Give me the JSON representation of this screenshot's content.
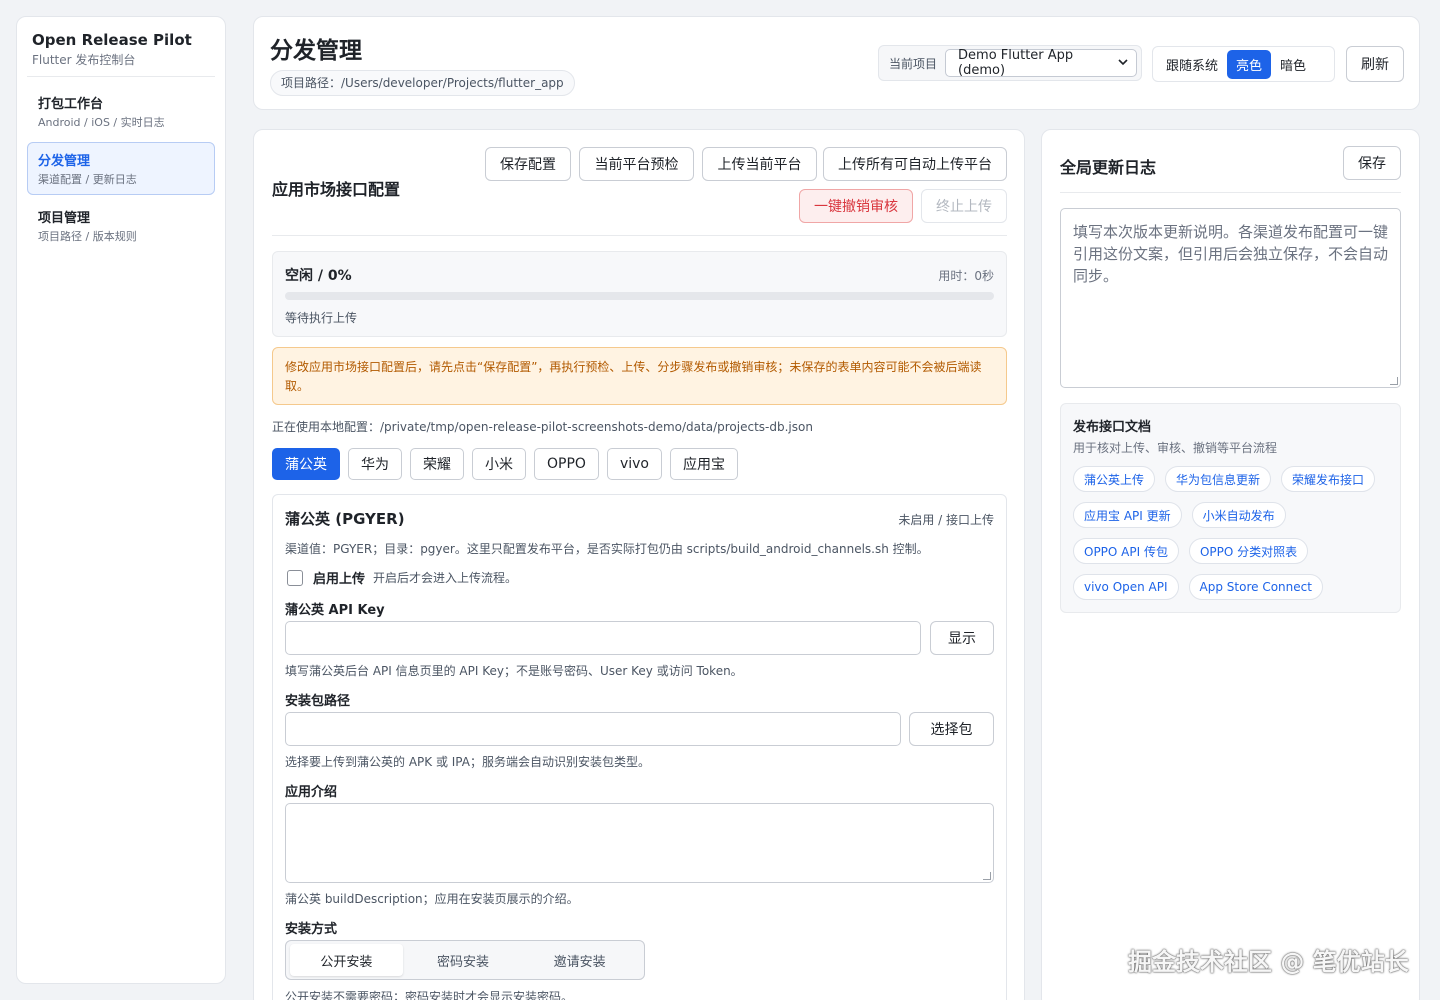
{
  "sidebar": {
    "brand_title": "Open Release Pilot",
    "brand_sub": "Flutter 发布控制台",
    "items": [
      {
        "title": "打包工作台",
        "sub": "Android / iOS / 实时日志"
      },
      {
        "title": "分发管理",
        "sub": "渠道配置 / 更新日志"
      },
      {
        "title": "项目管理",
        "sub": "项目路径 / 版本规则"
      }
    ]
  },
  "header": {
    "title": "分发管理",
    "path": "项目路径：/Users/developer/Projects/flutter_app",
    "project_label": "当前项目",
    "project_value": "Demo Flutter App (demo)",
    "theme": {
      "system": "跟随系统",
      "light": "亮色",
      "dark": "暗色"
    },
    "refresh": "刷新"
  },
  "main": {
    "title": "应用市场接口配置",
    "buttons": {
      "save": "保存配置",
      "precheck": "当前平台预检",
      "upload_current": "上传当前平台",
      "upload_all": "上传所有可自动上传平台",
      "revoke": "一键撤销审核",
      "stop": "终止上传"
    },
    "progress": {
      "status": "空闲 / 0%",
      "time": "用时：0秒",
      "percent": 0,
      "message": "等待执行上传"
    },
    "warning": "修改应用市场接口配置后，请先点击“保存配置”，再执行预检、上传、分步骤发布或撤销审核；未保存的表单内容可能不会被后端读取。",
    "local_config": "正在使用本地配置：/private/tmp/open-release-pilot-screenshots-demo/data/projects-db.json",
    "tabs": [
      "蒲公英",
      "华为",
      "荣耀",
      "小米",
      "OPPO",
      "vivo",
      "应用宝"
    ],
    "channel": {
      "title": "蒲公英 (PGYER)",
      "status": "未启用 / 接口上传",
      "desc": "渠道值：PGYER；目录：pgyer。这里只配置发布平台，是否实际打包仍由 scripts/build_android_channels.sh 控制。",
      "enable_label": "启用上传",
      "enable_hint": "开启后才会进入上传流程。",
      "api_key_label": "蒲公英 API Key",
      "api_key_value": "",
      "show_btn": "显示",
      "api_key_hint": "填写蒲公英后台 API 信息页里的 API Key；不是账号密码、User Key 或访问 Token。",
      "pkg_label": "安装包路径",
      "pkg_value": "",
      "choose_btn": "选择包",
      "pkg_hint": "选择要上传到蒲公英的 APK 或 IPA；服务端会自动识别安装包类型。",
      "desc_label": "应用介绍",
      "desc_value": "",
      "desc_hint": "蒲公英 buildDescription；应用在安装页展示的介绍。",
      "install_label": "安装方式",
      "install_options": [
        "公开安装",
        "密码安装",
        "邀请安装"
      ],
      "install_hint": "公开安装不需要密码；密码安装时才会显示安装密码。"
    }
  },
  "right": {
    "title": "全局更新日志",
    "save": "保存",
    "placeholder": "填写本次版本更新说明。各渠道发布配置可一键引用这份文案，但引用后会独立保存，不会自动同步。",
    "docs_title": "发布接口文档",
    "docs_sub": "用于核对上传、审核、撤销等平台流程",
    "links": [
      "蒲公英上传",
      "华为包信息更新",
      "荣耀发布接口",
      "应用宝 API 更新",
      "小米自动发布",
      "OPPO API 传包",
      "OPPO 分类对照表",
      "vivo Open API",
      "App Store Connect"
    ]
  },
  "watermark": "掘金技术社区 @ 笔优站长",
  "colors": {
    "accent": "#1d63e8",
    "danger": "#d9363e",
    "warning_text": "#b25a00",
    "warning_bg": "#fff3e2"
  }
}
